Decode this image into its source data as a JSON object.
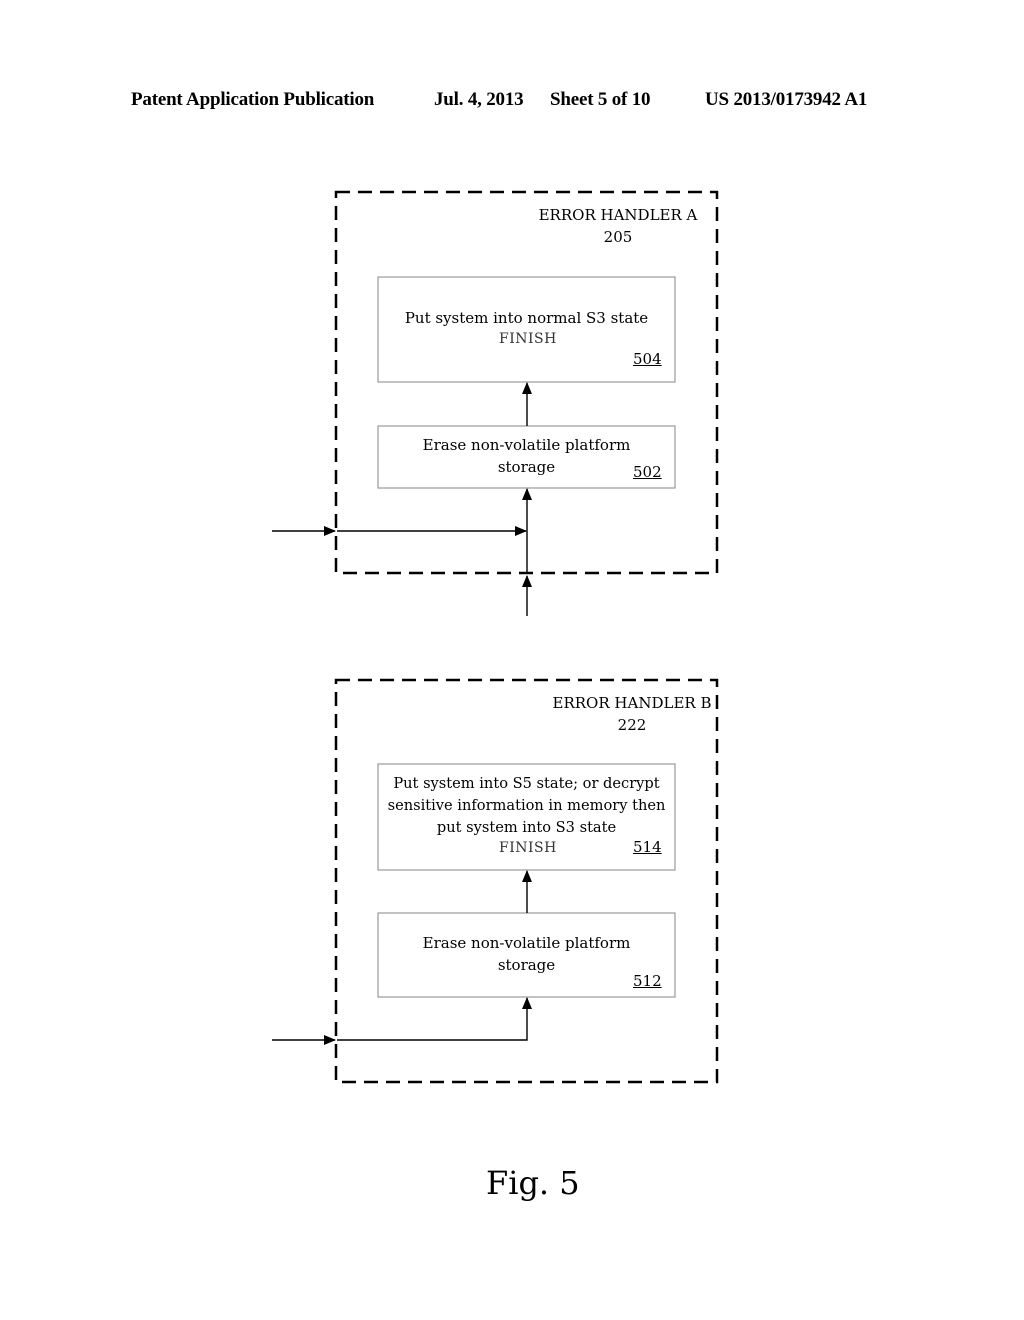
{
  "header": {
    "publication": "Patent Application Publication",
    "date": "Jul. 4, 2013",
    "sheet": "Sheet 5 of 10",
    "number": "US 2013/0173942 A1"
  },
  "handler_a": {
    "title": "ERROR HANDLER A",
    "ref": "205",
    "steps": [
      {
        "text": "Put system into normal S3 state",
        "status": "FINISH",
        "ref": "504"
      },
      {
        "text": "Erase non-volatile platform storage",
        "ref": "502"
      }
    ]
  },
  "handler_b": {
    "title": "ERROR HANDLER B",
    "ref": "222",
    "steps": [
      {
        "text": "Put system into S5 state; or decrypt sensitive information in memory then put system into S3 state",
        "status": "FINISH",
        "ref": "514"
      },
      {
        "text": "Erase non-volatile platform storage",
        "ref": "512"
      }
    ]
  },
  "figure_label": "Fig. 5"
}
